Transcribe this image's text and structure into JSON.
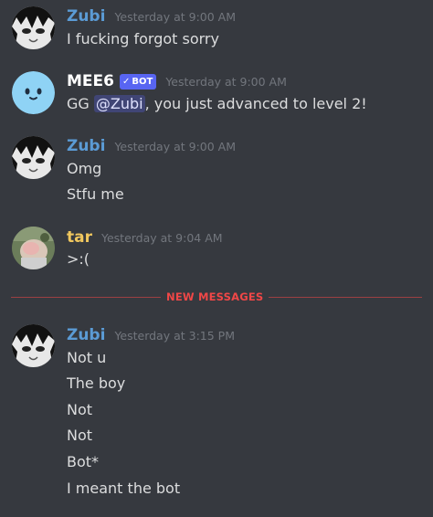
{
  "colors": {
    "background": "#36393f",
    "text": "#dcddde",
    "timestamp": "#72767d",
    "zubi_name": "#5b9bd5",
    "mee6_name": "#ffffff",
    "tar_name": "#f0c75e",
    "new_messages": "#f04747",
    "bot_badge": "#5865f2"
  },
  "messages": [
    {
      "author": "Zubi",
      "timestamp": "Yesterday at 9:00 AM",
      "lines": [
        "I fucking forgot sorry"
      ]
    },
    {
      "author": "MEE6",
      "badge": "BOT",
      "timestamp": "Yesterday at 9:00 AM",
      "text_before": "GG ",
      "mention": "@Zubi",
      "text_after": ", you just advanced to level 2!"
    },
    {
      "author": "Zubi",
      "timestamp": "Yesterday at 9:00 AM",
      "lines": [
        "Omg",
        "Stfu me"
      ]
    },
    {
      "author": "tar",
      "timestamp": "Yesterday at 9:04 AM",
      "lines": [
        ">:("
      ]
    },
    {
      "author": "Zubi",
      "timestamp": "Yesterday at 3:15 PM",
      "lines": [
        "Not u",
        "The boy",
        "Not",
        "Not",
        "Bot*",
        "I meant the bot"
      ]
    }
  ],
  "divider": {
    "label": "NEW MESSAGES"
  },
  "icons": {
    "zubi_avatar": "anime-avatar-icon",
    "mee6_avatar": "mee6-face-icon",
    "bot_check": "checkmark-icon",
    "tar_avatar": "photo-avatar-icon"
  }
}
